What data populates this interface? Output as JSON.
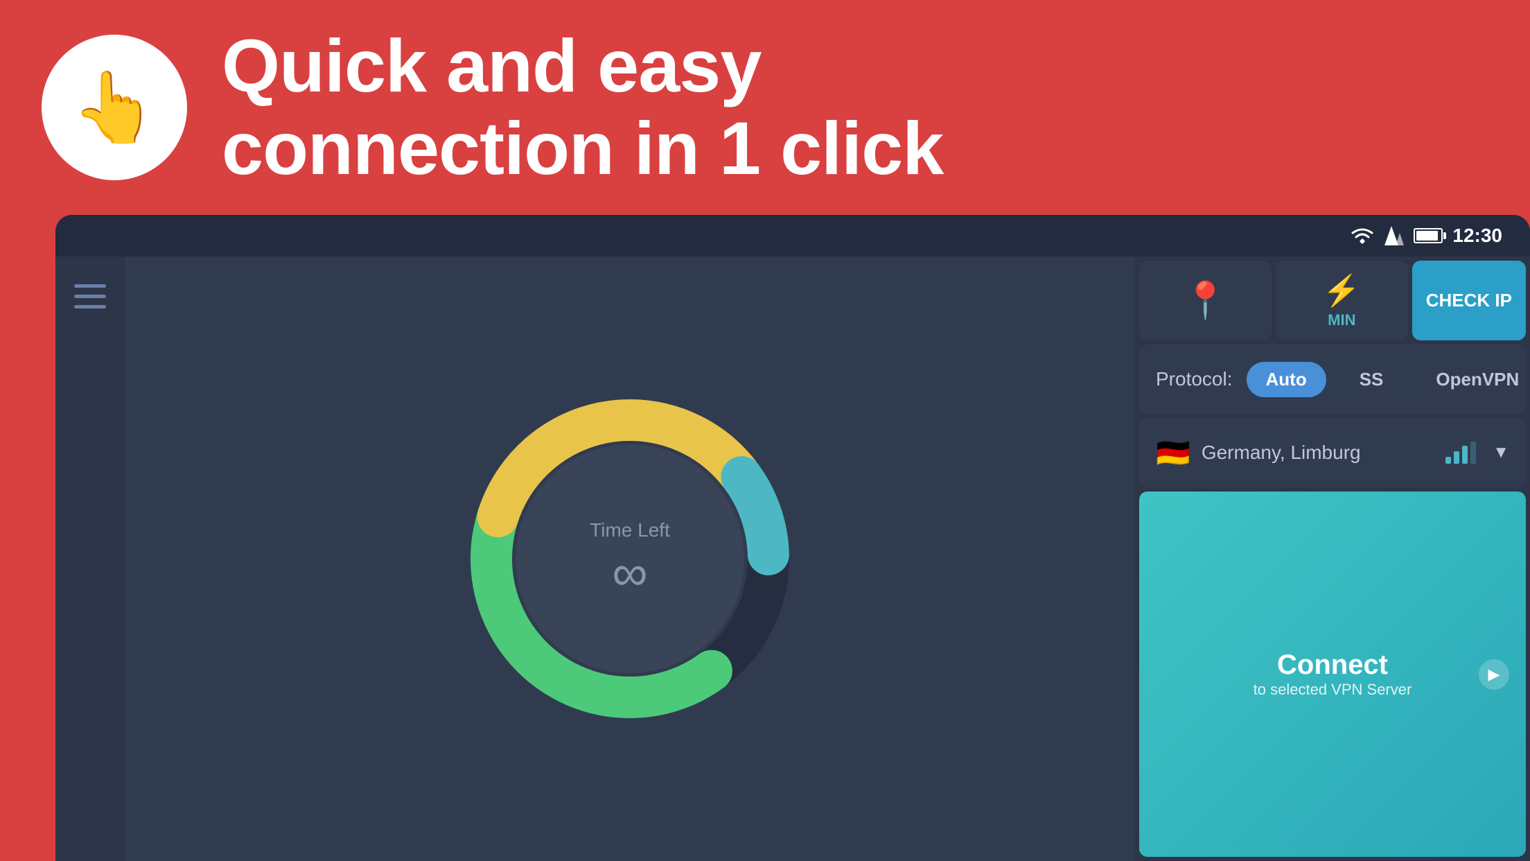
{
  "header": {
    "finger_emoji": "👆",
    "headline_line1": "Quick and easy",
    "headline_line2": "connection in 1 click"
  },
  "status_bar": {
    "time": "12:30"
  },
  "sidebar": {
    "menu_label": "Menu"
  },
  "donut": {
    "time_left_label": "Time Left",
    "infinity_symbol": "∞"
  },
  "right_panel": {
    "location_icon": "📍",
    "speed_lightning": "⚡",
    "speed_label": "MIN",
    "check_ip_label": "CHECK IP",
    "protocol_label": "Protocol:",
    "protocols": [
      "Auto",
      "SS",
      "OpenVPN"
    ],
    "active_protocol": "Auto",
    "flag_emoji": "🇩🇪",
    "server_name": "Germany, Limburg",
    "connect_text": "Connect",
    "connect_subtext": "to selected VPN Server"
  }
}
